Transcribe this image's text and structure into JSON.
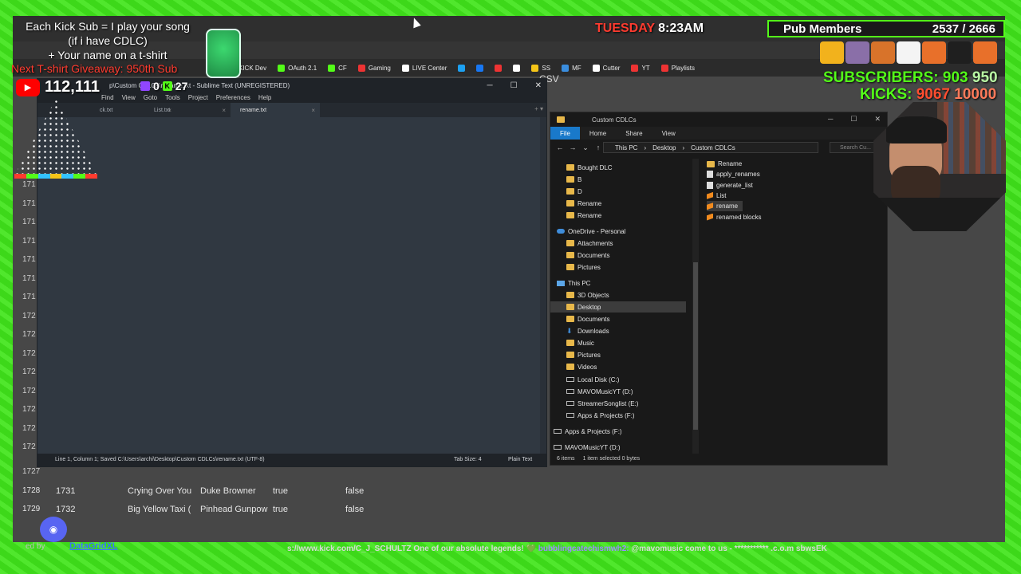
{
  "overlay": {
    "sub_goal_line1": "Each Kick Sub = I play your song",
    "sub_goal_line2": "(if i have CDLC)",
    "sub_goal_line3": "+ Your name on a t-shirt",
    "giveaway": "Next T-shirt Giveaway: 950th Sub",
    "youtube_count": "112,111",
    "twitch_count": "0",
    "kick_count": "27",
    "clock_day": "TUESDAY",
    "clock_time": "8:23AM",
    "pub_label": "Pub Members",
    "pub_count": "2537 / 2666",
    "subs_label": "SUBSCRIBERS:",
    "subs_current": "903",
    "subs_goal": "950",
    "kicks_label": "KICKS:",
    "kicks_current": "9067",
    "kicks_goal": "10000",
    "ticker_text": "s://www.kick.com/C_J_SCHULTZ One of our absolute legends! 💚 ",
    "ticker_user": "bubblingcatechismwh2:",
    "ticker_msg": " @mavomusic come to us - *********** .c.o.m sbwsEK"
  },
  "browser": {
    "bookmarks": [
      {
        "label": "KICK Dev",
        "color": "#53fc18"
      },
      {
        "label": "OAuth 2.1",
        "color": "#53fc18"
      },
      {
        "label": "CF",
        "color": "#53fc18"
      },
      {
        "label": "Gaming",
        "color": "#e33"
      },
      {
        "label": "LIVE Center",
        "color": "#fff"
      },
      {
        "label": "",
        "color": "#1da1f2"
      },
      {
        "label": "",
        "color": "#1877f2"
      },
      {
        "label": "",
        "color": "#e33"
      },
      {
        "label": "",
        "color": "#fff"
      },
      {
        "label": "SS",
        "color": "#f5c518"
      },
      {
        "label": "MF",
        "color": "#3a8dde"
      },
      {
        "label": "Cutter",
        "color": "#fff"
      },
      {
        "label": "YT",
        "color": "#e33"
      },
      {
        "label": "Playlists",
        "color": "#e33"
      }
    ],
    "csv_label": "CSV",
    "row_numbers_partial": [
      "171",
      "171",
      "171",
      "171",
      "171",
      "171",
      "171",
      "172",
      "172",
      "172",
      "172",
      "172",
      "172",
      "172",
      "172"
    ],
    "rows": [
      {
        "idx": "1728",
        "num": "1731",
        "title": "Crying Over You",
        "artist": "Duke Browner",
        "a": "true",
        "b": "false"
      },
      {
        "idx": "1729",
        "num": "1732",
        "title": "Big Yellow Taxi (",
        "artist": "Pinhead Gunpow",
        "a": "true",
        "b": "false"
      }
    ],
    "partial_row_idx": "1727",
    "made_by": "ed by",
    "datagrid": "DataGridXL"
  },
  "sublime": {
    "title": "p\\Custom CDLCs\\rename.txt - Sublime Text (UNREGISTERED)",
    "menu": [
      "Find",
      "View",
      "Goto",
      "Tools",
      "Project",
      "Preferences",
      "Help"
    ],
    "tabs": [
      "ck.txt",
      "List.txt",
      "rename.txt"
    ],
    "status_left": "Line 1, Column 1; Saved C:\\Users\\archi\\Desktop\\Custom CDLCs\\rename.txt (UTF-8)",
    "status_tab": "Tab Size: 4",
    "status_syntax": "Plain Text"
  },
  "explorer": {
    "title": "Custom CDLCs",
    "ribbon": [
      "File",
      "Home",
      "Share",
      "View"
    ],
    "breadcrumb": [
      "This PC",
      "Desktop",
      "Custom CDLCs"
    ],
    "search_placeholder": "Search Cu...",
    "nav_items": [
      {
        "label": "Bought DLC",
        "icon": "folder"
      },
      {
        "label": "B",
        "icon": "folder"
      },
      {
        "label": "D",
        "icon": "folder"
      },
      {
        "label": "Rename",
        "icon": "folder"
      },
      {
        "label": "Rename",
        "icon": "folder"
      },
      {
        "label": "OneDrive - Personal",
        "icon": "cloud"
      },
      {
        "label": "Attachments",
        "icon": "folder"
      },
      {
        "label": "Documents",
        "icon": "folder"
      },
      {
        "label": "Pictures",
        "icon": "folder"
      },
      {
        "label": "This PC",
        "icon": "pc"
      },
      {
        "label": "3D Objects",
        "icon": "folder"
      },
      {
        "label": "Desktop",
        "icon": "folder"
      },
      {
        "label": "Documents",
        "icon": "folder"
      },
      {
        "label": "Downloads",
        "icon": "download"
      },
      {
        "label": "Music",
        "icon": "folder"
      },
      {
        "label": "Pictures",
        "icon": "folder"
      },
      {
        "label": "Videos",
        "icon": "folder"
      },
      {
        "label": "Local Disk (C:)",
        "icon": "drive"
      },
      {
        "label": "MAVOMusicYT (D:)",
        "icon": "drive"
      },
      {
        "label": "StreamerSonglist (E:)",
        "icon": "drive"
      },
      {
        "label": "Apps & Projects (F:)",
        "icon": "drive"
      },
      {
        "label": "Apps & Projects (F:)",
        "icon": "drive"
      },
      {
        "label": "MAVOMusicYT (D:)",
        "icon": "drive"
      }
    ],
    "files": [
      {
        "label": "Rename",
        "icon": "folder"
      },
      {
        "label": "apply_renames",
        "icon": "text"
      },
      {
        "label": "generate_list",
        "icon": "text"
      },
      {
        "label": "List",
        "icon": "sublime"
      },
      {
        "label": "rename",
        "icon": "sublime"
      },
      {
        "label": "renamed blocks",
        "icon": "sublime"
      }
    ],
    "status_items": "6 items",
    "status_selected": "1 item selected  0 bytes"
  }
}
